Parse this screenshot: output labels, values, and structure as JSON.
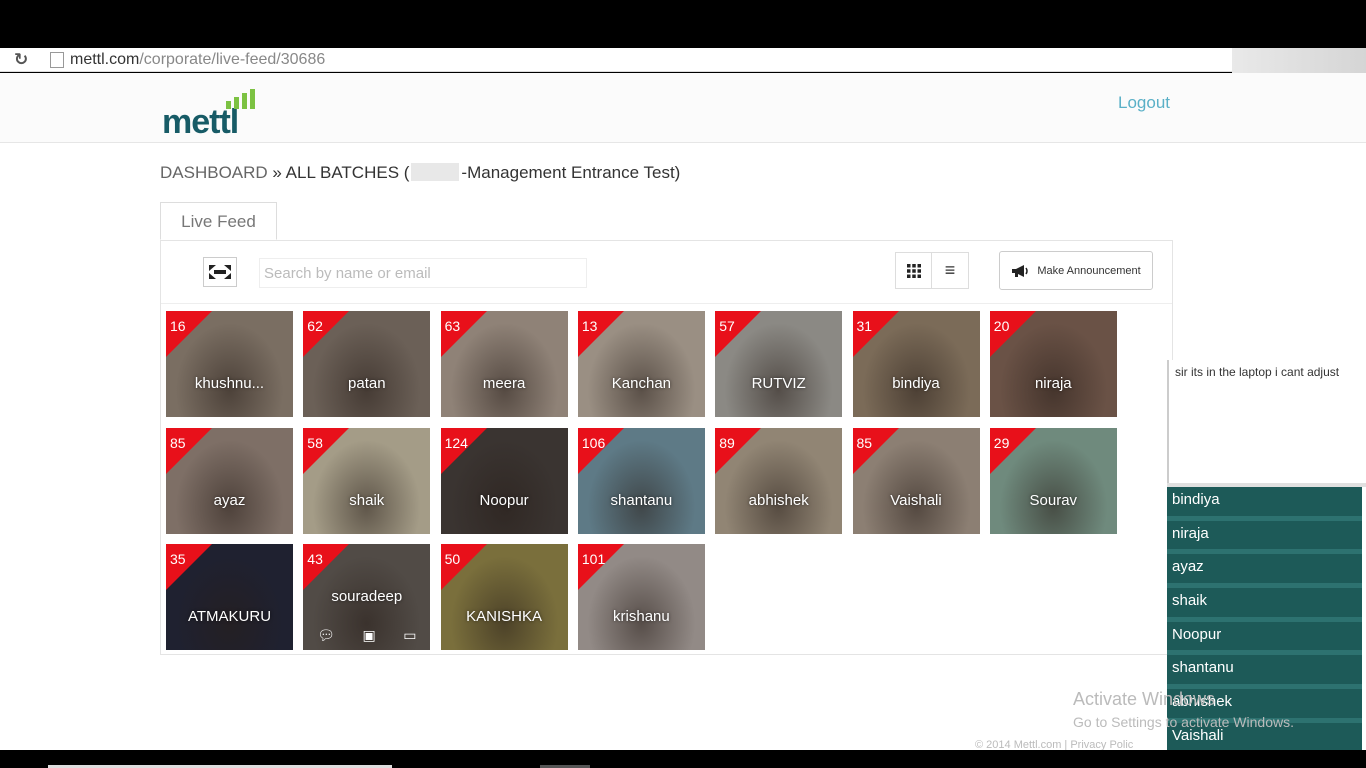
{
  "browser": {
    "url_host": "mettl.com",
    "url_path": "/corporate/live-feed/30686"
  },
  "header": {
    "logo_text": "mettl",
    "logout_label": "Logout"
  },
  "breadcrumb": {
    "dashboard": "DASHBOARD",
    "separator": " » ",
    "all_batches": "ALL BATCHES (",
    "test_name": "-Management Entrance Test)"
  },
  "tab": {
    "label": "Live Feed"
  },
  "toolbar": {
    "search_placeholder": "Search by name or email",
    "announce_label": "Make Announcement"
  },
  "tiles": [
    {
      "score": "16",
      "name": "khushnu...",
      "bg": "#7a6e62"
    },
    {
      "score": "62",
      "name": "patan",
      "bg": "#6b6057"
    },
    {
      "score": "63",
      "name": "meera",
      "bg": "#8f8277"
    },
    {
      "score": "13",
      "name": "Kanchan",
      "bg": "#9a8f83"
    },
    {
      "score": "57",
      "name": "RUTVIZ",
      "bg": "#8b8984"
    },
    {
      "score": "31",
      "name": "bindiya",
      "bg": "#7b6b58"
    },
    {
      "score": "20",
      "name": "niraja",
      "bg": "#6a5246"
    },
    {
      "score": "85",
      "name": "ayaz",
      "bg": "#7e6f66"
    },
    {
      "score": "58",
      "name": "shaik",
      "bg": "#a49c87"
    },
    {
      "score": "124",
      "name": "Noopur",
      "bg": "#3a3431"
    },
    {
      "score": "106",
      "name": "shantanu",
      "bg": "#5e7a86"
    },
    {
      "score": "89",
      "name": "abhishek",
      "bg": "#918574"
    },
    {
      "score": "85",
      "name": "Vaishali",
      "bg": "#8c7f73"
    },
    {
      "score": "29",
      "name": "Sourav",
      "bg": "#6f8a7d"
    },
    {
      "score": "35",
      "name": "ATMAKURU",
      "bg": "#1f2130"
    },
    {
      "score": "43",
      "name": "souradeep",
      "bg": "#514b46"
    },
    {
      "score": "50",
      "name": "KANISHKA",
      "bg": "#7a6f3c"
    },
    {
      "score": "101",
      "name": "krishanu",
      "bg": "#928a86"
    }
  ],
  "chat": {
    "message": "sir its in the laptop i cant adjust"
  },
  "name_list": [
    "bindiya",
    "niraja",
    "ayaz",
    "shaik",
    "Noopur",
    "shantanu",
    "abhishek",
    "Vaishali"
  ],
  "watermark": {
    "line1": "Activate Windows",
    "line2": "Go to Settings to activate Windows."
  },
  "footer": {
    "text": "© 2014 Mettl.com | Privacy Polic"
  }
}
